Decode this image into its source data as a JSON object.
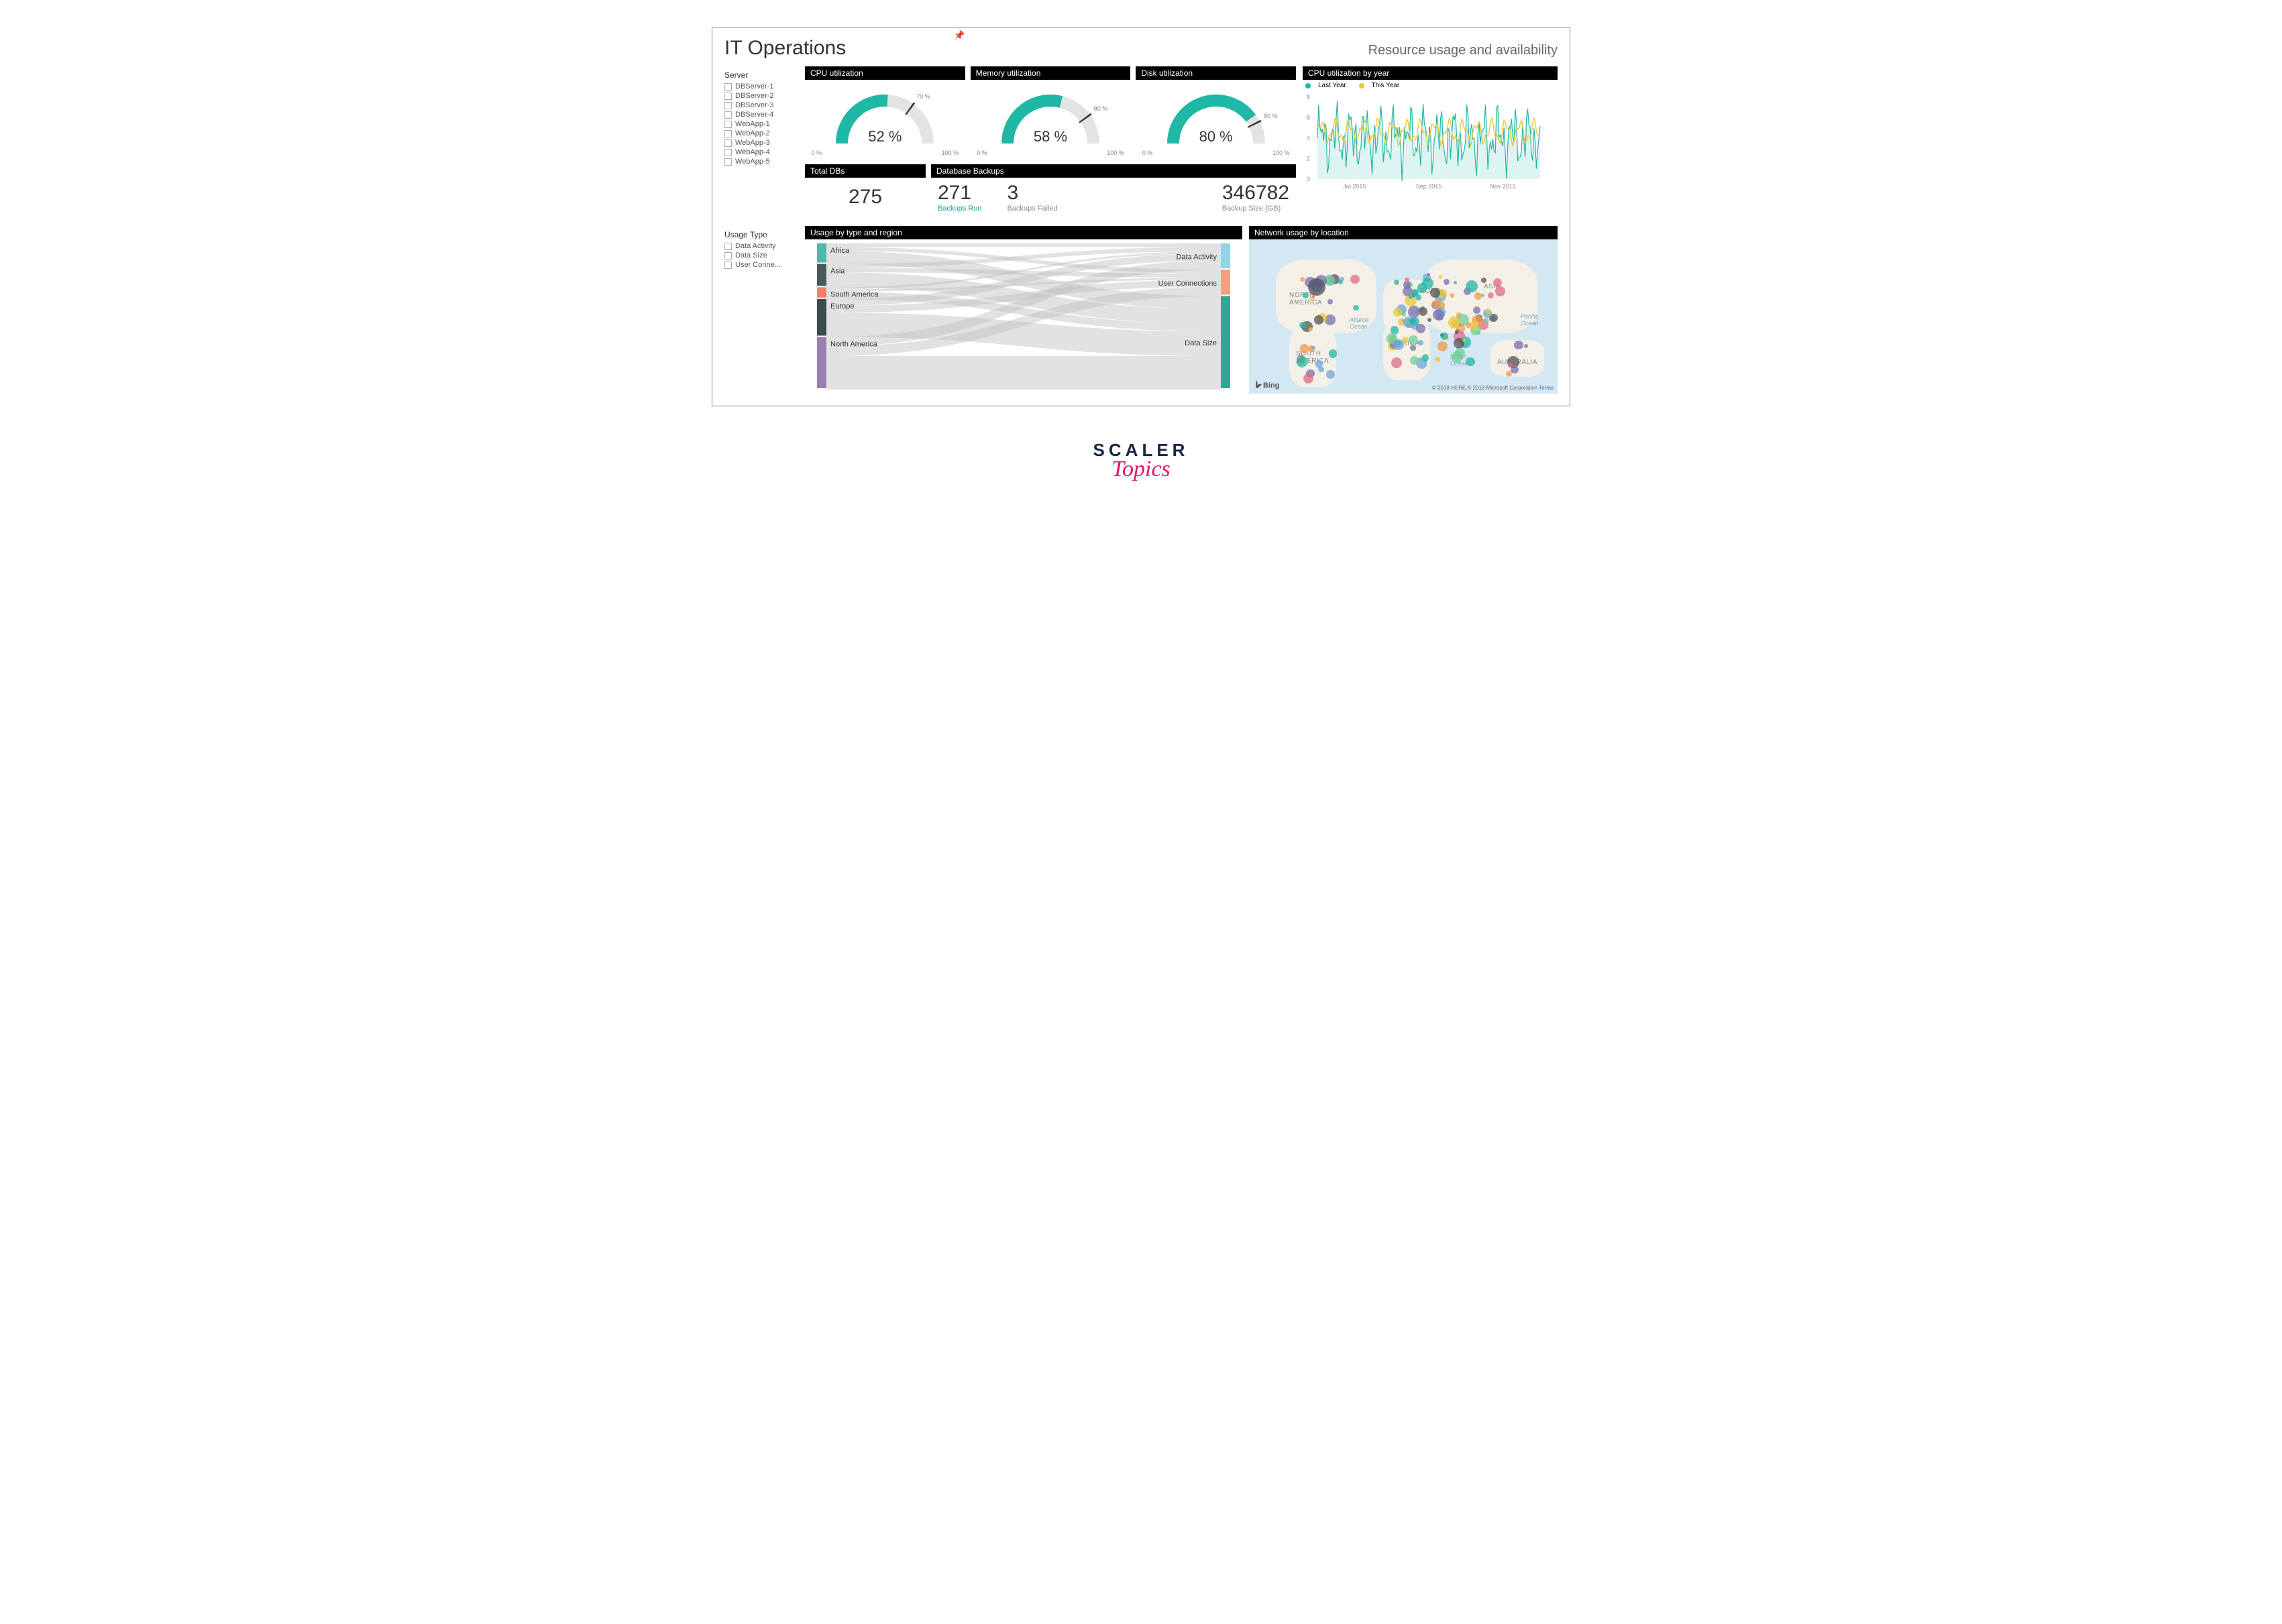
{
  "header": {
    "title": "IT Operations",
    "subtitle": "Resource usage and availability"
  },
  "slicers": {
    "server": {
      "title": "Server",
      "items": [
        "DBServer-1",
        "DBServer-2",
        "DBServer-3",
        "DBServer-4",
        "WebApp-1",
        "WebApp-2",
        "WebApp-3",
        "WebApp-4",
        "WebApp-5"
      ]
    },
    "usage": {
      "title": "Usage Type",
      "items": [
        "Data Activity",
        "Data Size",
        "User Conne..."
      ]
    }
  },
  "gauges": {
    "cpu": {
      "title": "CPU utilization",
      "value": "52 %",
      "pct": 52,
      "target": 70,
      "targetLabel": "70 %",
      "min": "0 %",
      "max": "100 %"
    },
    "memory": {
      "title": "Memory utilization",
      "value": "58 %",
      "pct": 58,
      "target": 80,
      "targetLabel": "80 %",
      "min": "0 %",
      "max": "100 %"
    },
    "disk": {
      "title": "Disk utilization",
      "value": "80 %",
      "pct": 80,
      "target": 85,
      "targetLabel": "80 %",
      "min": "0 %",
      "max": "100 %"
    }
  },
  "kpis": {
    "totalDbs": {
      "title": "Total DBs",
      "value": "275"
    },
    "backups": {
      "title": "Database Backups",
      "run": {
        "value": "271",
        "label": "Backups Run"
      },
      "failed": {
        "value": "3",
        "label": "Backups Failed"
      },
      "size": {
        "value": "346782",
        "label": "Backup Size (GB)"
      }
    }
  },
  "cpuYear": {
    "title": "CPU utilization by year",
    "legend": {
      "last": "Last Year",
      "this": "This Year"
    },
    "yticks": [
      "0",
      "2",
      "4",
      "6",
      "8"
    ],
    "xticks": [
      "Jul 2015",
      "Sep 2015",
      "Nov 2015"
    ]
  },
  "sankey": {
    "title": "Usage by type and region",
    "left": [
      "Africa",
      "Asia",
      "South America",
      "Europe",
      "North America"
    ],
    "right": [
      "Data Activity",
      "User Connections",
      "Data Size"
    ]
  },
  "map": {
    "title": "Network usage by location",
    "continents": [
      "NORTH AMERICA",
      "SOUTH AMERICA",
      "AFRICA",
      "ASIA",
      "AUSTRALIA"
    ],
    "europeLabel": "ROPE",
    "oceans": [
      "Atlantic Ocean",
      "Indian Ocean",
      "Pacific Ocean"
    ],
    "provider": "Bing",
    "attribution": "© 2018 HERE,© 2018 Microsoft Corporation",
    "terms": "Terms"
  },
  "brand": {
    "top": "SCALER",
    "bottom": "Topics"
  },
  "colors": {
    "teal": "#1fb7a6",
    "tealDark": "#0f8f82",
    "yellow": "#e8c93a",
    "sankeyLeft": [
      "#4fb8ab",
      "#4a5a5a",
      "#f08070",
      "#3c4c4c",
      "#9b7fb0"
    ],
    "sankeyRight": [
      "#8fd4e8",
      "#f2a07e",
      "#2ea896"
    ]
  },
  "chart_data": [
    {
      "type": "gauge",
      "title": "CPU utilization",
      "value": 52,
      "min": 0,
      "max": 100,
      "target": 70,
      "unit": "%"
    },
    {
      "type": "gauge",
      "title": "Memory utilization",
      "value": 58,
      "min": 0,
      "max": 100,
      "target": 80,
      "unit": "%"
    },
    {
      "type": "gauge",
      "title": "Disk utilization",
      "value": 80,
      "min": 0,
      "max": 100,
      "target": 85,
      "unit": "%"
    },
    {
      "type": "card",
      "title": "Total DBs",
      "value": 275
    },
    {
      "type": "card-multi",
      "title": "Database Backups",
      "metrics": [
        {
          "label": "Backups Run",
          "value": 271
        },
        {
          "label": "Backups Failed",
          "value": 3
        },
        {
          "label": "Backup Size (GB)",
          "value": 346782
        }
      ]
    },
    {
      "type": "line",
      "title": "CPU utilization by year",
      "xlabel": "",
      "ylabel": "",
      "ylim": [
        0,
        8
      ],
      "x_range": [
        "Jun 2015",
        "Dec 2015"
      ],
      "x_ticks": [
        "Jul 2015",
        "Sep 2015",
        "Nov 2015"
      ],
      "series": [
        {
          "name": "Last Year",
          "color": "#1fb7a6",
          "note": "high-variance daily series oscillating roughly between 1 and 7"
        },
        {
          "name": "This Year",
          "color": "#e8c93a",
          "note": "lower-variance daily series centred around 4–5"
        }
      ]
    },
    {
      "type": "sankey",
      "title": "Usage by type and region",
      "left_nodes": [
        {
          "name": "Africa",
          "weight": 14
        },
        {
          "name": "Asia",
          "weight": 16
        },
        {
          "name": "South America",
          "weight": 8
        },
        {
          "name": "Europe",
          "weight": 26
        },
        {
          "name": "North America",
          "weight": 36
        }
      ],
      "right_nodes": [
        {
          "name": "Data Activity",
          "weight": 18
        },
        {
          "name": "User Connections",
          "weight": 18
        },
        {
          "name": "Data Size",
          "weight": 64
        }
      ],
      "note": "Every region flows to all three usage types; North America and Europe dominate Data Size."
    },
    {
      "type": "map-bubble",
      "title": "Network usage by location",
      "projection": "world",
      "note": "Dense cluster of multi-coloured bubbles over Europe, West Africa, South/East Asia and US east coast; sparse over Australia and Pacific.",
      "provider": "Bing"
    }
  ]
}
